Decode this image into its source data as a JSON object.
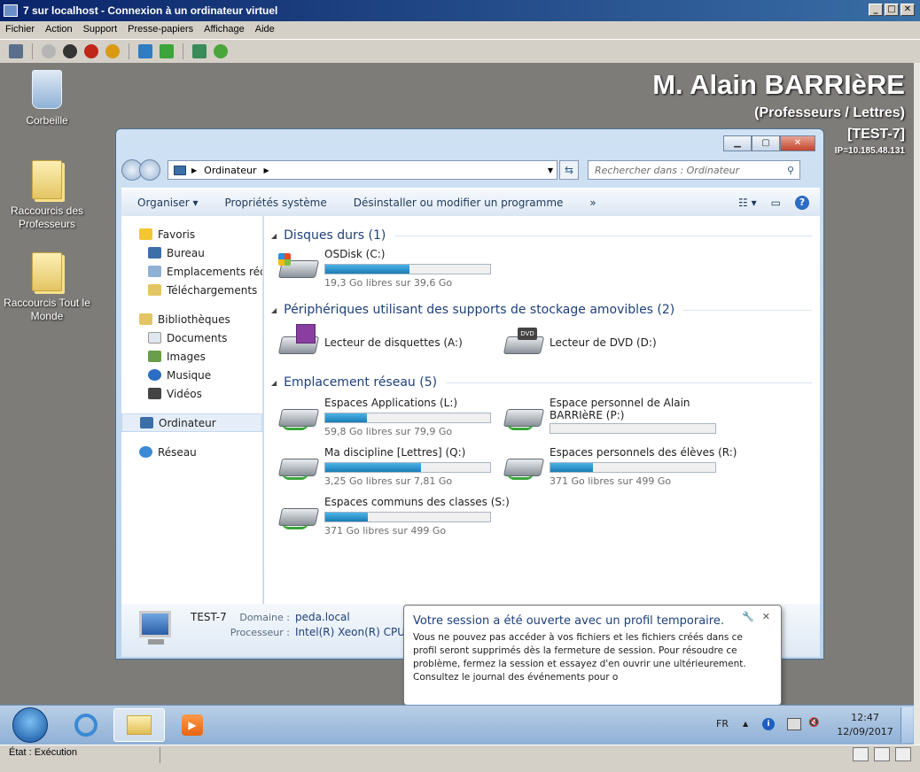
{
  "host": {
    "title": "7 sur localhost - Connexion à un ordinateur virtuel",
    "menu": [
      "Fichier",
      "Action",
      "Support",
      "Presse-papiers",
      "Affichage",
      "Aide"
    ],
    "status": "État : Exécution"
  },
  "desktop": {
    "icons": [
      {
        "label": "Corbeille"
      },
      {
        "label": "Raccourcis des Professeurs"
      },
      {
        "label": "Raccourcis Tout le Monde"
      }
    ],
    "user": {
      "name": "M. Alain BARRIèRE",
      "group": "(Professeurs / Lettres)",
      "host": "[TEST-7]",
      "ip": "IP=10.185.48.131"
    }
  },
  "explorer": {
    "address": "Ordinateur",
    "search_placeholder": "Rechercher dans : Ordinateur",
    "commands": [
      "Organiser",
      "Propriétés système",
      "Désinstaller ou modifier un programme",
      "»"
    ],
    "nav": {
      "favorites": "Favoris",
      "bureau": "Bureau",
      "recent": "Emplacements récer",
      "downloads": "Téléchargements",
      "libraries": "Bibliothèques",
      "documents": "Documents",
      "images": "Images",
      "music": "Musique",
      "videos": "Vidéos",
      "computer": "Ordinateur",
      "network": "Réseau"
    },
    "groups": {
      "hdd": "Disques durs (1)",
      "removable": "Périphériques utilisant des supports de stockage amovibles (2)",
      "network": "Emplacement réseau (5)"
    },
    "drives": {
      "osdisk": {
        "name": "OSDisk (C:)",
        "free": "19,3 Go libres sur 39,6 Go",
        "used_fraction": 0.51
      },
      "floppy": {
        "name": "Lecteur de disquettes (A:)"
      },
      "dvd": {
        "name": "Lecteur de DVD (D:)"
      },
      "apps": {
        "name": "Espaces Applications (L:)",
        "free": "59,8 Go libres sur 79,9 Go",
        "used_fraction": 0.25
      },
      "personal": {
        "name_line1": "Espace personnel de Alain",
        "name_line2": "BARRIèRE (P:)",
        "used_fraction": 0.0
      },
      "discipline": {
        "name": "Ma discipline [Lettres] (Q:)",
        "free": "3,25 Go libres sur 7,81 Go",
        "used_fraction": 0.58
      },
      "students": {
        "name": "Espaces personnels des élèves (R:)",
        "free": "371 Go libres sur 499 Go",
        "used_fraction": 0.26
      },
      "classes": {
        "name": "Espaces communs des classes (S:)",
        "free": "371 Go libres sur 499 Go",
        "used_fraction": 0.26
      }
    },
    "details": {
      "name": "TEST-7",
      "domain_label": "Domaine :",
      "domain": "peda.local",
      "processor_label": "Processeur :",
      "processor": "Intel(R) Xeon(R) CPU"
    }
  },
  "balloon": {
    "title": "Votre session a été ouverte avec un profil temporaire.",
    "text": "Vous ne pouvez pas accéder à vos fichiers et les fichiers créés dans ce profil seront supprimés dès la fermeture de session. Pour résoudre ce problème, fermez la session et essayez d'en ouvrir une ultérieurement. Consultez le journal des événements pour o"
  },
  "taskbar": {
    "lang": "FR",
    "time": "12:47",
    "date": "12/09/2017"
  }
}
